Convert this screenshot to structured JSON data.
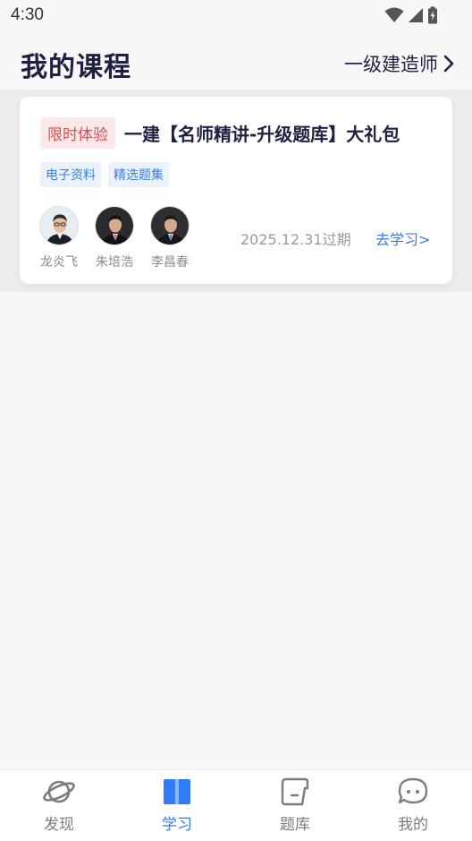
{
  "status_bar": {
    "time": "4:30"
  },
  "header": {
    "title": "我的课程",
    "exam_selector": "一级建造师"
  },
  "course": {
    "badge": "限时体验",
    "title": "一建【名师精讲-升级题库】大礼包",
    "tags": [
      "电子资料",
      "精选题集"
    ],
    "teachers": [
      {
        "name": "龙炎飞"
      },
      {
        "name": "朱培浩"
      },
      {
        "name": "李昌春"
      }
    ],
    "expiry": "2025.12.31过期",
    "action": "去学习>"
  },
  "tabs": [
    {
      "label": "发现",
      "icon": "planet-icon",
      "active": false
    },
    {
      "label": "学习",
      "icon": "book-icon",
      "active": true
    },
    {
      "label": "题库",
      "icon": "question-bank-icon",
      "active": false
    },
    {
      "label": "我的",
      "icon": "chat-bubble-icon",
      "active": false
    }
  ],
  "colors": {
    "accent": "#2f7cf6",
    "badge_red": "#e5484d",
    "title_dark": "#1f2140"
  }
}
